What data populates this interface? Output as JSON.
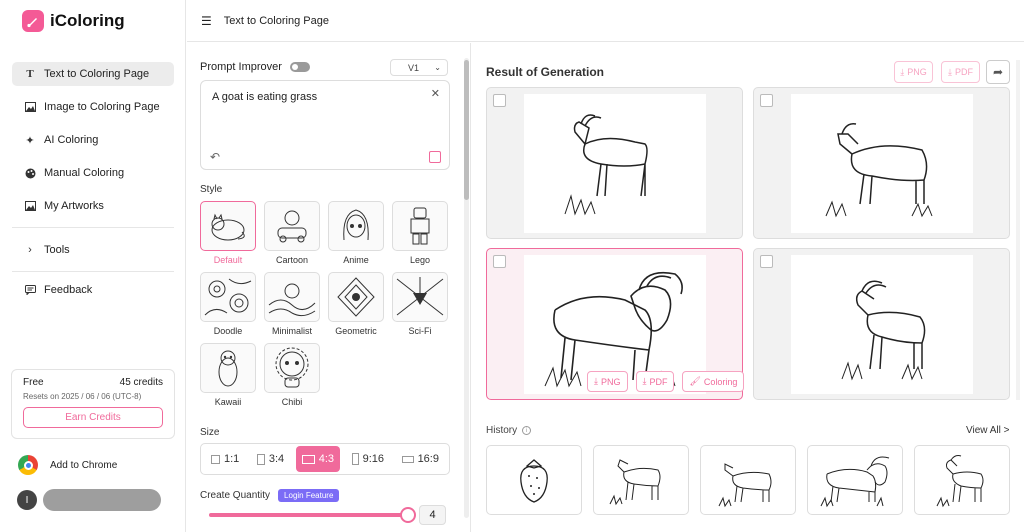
{
  "app": {
    "name": "iColoring"
  },
  "header": {
    "title": "Text to Coloring Page"
  },
  "sidebar": {
    "items": [
      {
        "label": "Text to Coloring Page",
        "icon": "text-icon"
      },
      {
        "label": "Image to Coloring Page",
        "icon": "image-icon"
      },
      {
        "label": "AI Coloring",
        "icon": "sparkle-icon"
      },
      {
        "label": "Manual Coloring",
        "icon": "palette-icon"
      },
      {
        "label": "My Artworks",
        "icon": "gallery-icon"
      }
    ],
    "tools": "Tools",
    "feedback": "Feedback"
  },
  "credits": {
    "plan": "Free",
    "amount": "45 credits",
    "reset": "Resets on 2025 / 06 / 06 (UTC-8)",
    "earn": "Earn Credits"
  },
  "chrome": {
    "label": "Add to Chrome"
  },
  "user": {
    "initial": "I"
  },
  "prompt": {
    "improver_label": "Prompt Improver",
    "version": "V1",
    "text": "A goat is eating grass"
  },
  "style": {
    "label": "Style",
    "options": [
      "Default",
      "Cartoon",
      "Anime",
      "Lego",
      "Doodle",
      "Minimalist",
      "Geometric",
      "Sci-Fi",
      "Kawaii",
      "Chibi"
    ],
    "selected": "Default"
  },
  "size": {
    "label": "Size",
    "options": [
      "1:1",
      "3:4",
      "4:3",
      "9:16",
      "16:9"
    ],
    "selected": "4:3"
  },
  "quantity": {
    "label": "Create Quantity",
    "badge": "Login Feature",
    "value": "4"
  },
  "result": {
    "title": "Result of Generation",
    "png": "PNG",
    "pdf": "PDF",
    "actions": {
      "png": "PNG",
      "pdf": "PDF",
      "coloring": "Coloring"
    }
  },
  "history": {
    "label": "History",
    "view_all": "View All >"
  },
  "colors": {
    "accent": "#f06a9b",
    "badge": "#7b6cf6"
  }
}
